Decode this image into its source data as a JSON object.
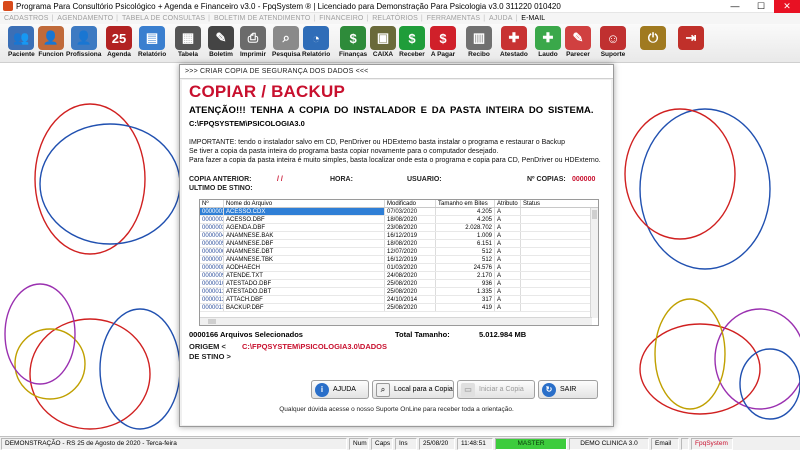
{
  "window": {
    "title": "Programa Para Consultório Psicológico + Agenda e Financeiro v3.0 - FpqSystem ® | Licenciado para  Demonstração Para Psicologia v3.0 311220 010420",
    "min": "—",
    "max": "☐",
    "close": "✕"
  },
  "menu": [
    {
      "label": "CADASTROS",
      "active": false
    },
    {
      "label": "AGENDAMENTO",
      "active": false
    },
    {
      "label": "TABELA DE CONSULTAS",
      "active": false
    },
    {
      "label": "BOLETIM DE ATENDIMENTO",
      "active": false
    },
    {
      "label": "FINANCEIRO",
      "active": false
    },
    {
      "label": "RELATÓRIOS",
      "active": false
    },
    {
      "label": "FERRAMENTAS",
      "active": false
    },
    {
      "label": "AJUDA",
      "active": false
    },
    {
      "label": "E-MAIL",
      "active": true
    }
  ],
  "toolbar": [
    {
      "label": "Paciente",
      "icon": "patients-icon",
      "color": "#3b6fb6",
      "glyph": "👥"
    },
    {
      "label": "Funcion",
      "icon": "employee-icon",
      "color": "#c06a3a",
      "glyph": "👤"
    },
    {
      "label": "Profissiona",
      "icon": "professional-icon",
      "color": "#3d7ac2",
      "glyph": "👤"
    },
    {
      "label": "Agenda",
      "icon": "calendar-icon",
      "color": "#b22222",
      "glyph": "25"
    },
    {
      "label": "Relatório",
      "icon": "report-icon",
      "color": "#3a7fcf",
      "glyph": "▤"
    },
    {
      "label": "Tabela",
      "icon": "table-icon",
      "color": "#555555",
      "glyph": "▦"
    },
    {
      "label": "Boletim",
      "icon": "bulletin-icon",
      "color": "#444444",
      "glyph": "✎"
    },
    {
      "label": "Imprimir",
      "icon": "printer-icon",
      "color": "#6b6b6b",
      "glyph": "⎙"
    },
    {
      "label": "Pesquisa",
      "icon": "search-icon",
      "color": "#8a8a8a",
      "glyph": "⌕"
    },
    {
      "label": "Relatório",
      "icon": "report-chart-icon",
      "color": "#2f6db8",
      "glyph": "◔"
    },
    {
      "label": "Finanças",
      "icon": "finance-icon",
      "color": "#2e8b3a",
      "glyph": "$"
    },
    {
      "label": "CAIXA",
      "icon": "cashbox-icon",
      "color": "#6a6a3a",
      "glyph": "▣"
    },
    {
      "label": "Receber",
      "icon": "receive-icon",
      "color": "#1f9d3a",
      "glyph": "$"
    },
    {
      "label": "A Pagar",
      "icon": "pay-icon",
      "color": "#d0202a",
      "glyph": "$"
    },
    {
      "label": "Recibo",
      "icon": "receipt-icon",
      "color": "#707070",
      "glyph": "▥"
    },
    {
      "label": "Atestado",
      "icon": "certificate-icon",
      "color": "#c83232",
      "glyph": "✚"
    },
    {
      "label": "Laudo",
      "icon": "report-doc-icon",
      "color": "#3aa84a",
      "glyph": "✚"
    },
    {
      "label": "Parecer",
      "icon": "opinion-icon",
      "color": "#d04040",
      "glyph": "✎"
    },
    {
      "label": "Suporte",
      "icon": "support-icon",
      "color": "#c03030",
      "glyph": "☺"
    },
    {
      "label": "",
      "icon": "power-icon",
      "color": "#a07a20",
      "glyph": "⏻"
    },
    {
      "label": "",
      "icon": "exit-icon",
      "color": "#c0302a",
      "glyph": "⇥"
    }
  ],
  "dialog": {
    "title": ">>> CRIAR COPIA DE SEGURANÇA DOS DADOS <<<",
    "heading": "COPIAR / BACKUP",
    "attention": "ATENÇÃO!!!  TENHA A COPIA DO INSTALADOR E DA PASTA INTEIRA DO SISTEMA.",
    "path": "C:\\FPQSYSTEM\\PSICOLOGIA3.0",
    "info": [
      "IMPORTANTE: tendo o instalador salvo em CD, PenDriver ou HDExterno basta instalar o programa e restaurar o Backup",
      "Se tiver a copia da pasta inteira do programa basta copiar novamente para o computador desejado.",
      "Para fazer a copia da pasta inteira é muito simples, basta localizar onde esta o programa e copia para CD, PenDriver ou HDExterno."
    ],
    "last_copy_label": "COPIA ANTERIOR:",
    "last_copy_value": "/  /",
    "hour_label": "HORA:",
    "user_label": "USUARIO:",
    "copies_label": "Nº COPIAS:",
    "copies_value": "000000",
    "last_dest_label": "ULTIMO DE STINO:",
    "grid": {
      "columns": [
        "Nº",
        "Nome do Arquivo",
        "Modificado",
        "Tamanho em Bites",
        "Atributo",
        "Status"
      ],
      "rows": [
        {
          "no": "0000001",
          "name": "ACESSO.CDX",
          "mod": "07/03/2020",
          "size": "4.205",
          "attr": "A",
          "status": ""
        },
        {
          "no": "0000002",
          "name": "ACESSO.DBF",
          "mod": "18/08/2020",
          "size": "4.205",
          "attr": "A",
          "status": ""
        },
        {
          "no": "0000003",
          "name": "AGENDA.DBF",
          "mod": "23/08/2020",
          "size": "2.028.702",
          "attr": "A",
          "status": ""
        },
        {
          "no": "0000004",
          "name": "ANAMNESE.BAK",
          "mod": "16/12/2019",
          "size": "1.009",
          "attr": "A",
          "status": ""
        },
        {
          "no": "0000005",
          "name": "ANAMNESE.DBF",
          "mod": "18/08/2020",
          "size": "6.151",
          "attr": "A",
          "status": ""
        },
        {
          "no": "0000006",
          "name": "ANAMNESE.DBT",
          "mod": "12/07/2020",
          "size": "512",
          "attr": "A",
          "status": ""
        },
        {
          "no": "0000007",
          "name": "ANAMNESE.TBK",
          "mod": "16/12/2019",
          "size": "512",
          "attr": "A",
          "status": ""
        },
        {
          "no": "0000008",
          "name": "AODHAECH",
          "mod": "01/03/2020",
          "size": "24.576",
          "attr": "A",
          "status": ""
        },
        {
          "no": "0000009",
          "name": "ATENDE.TXT",
          "mod": "24/08/2020",
          "size": "2.170",
          "attr": "A",
          "status": ""
        },
        {
          "no": "0000010",
          "name": "ATESTADO.DBF",
          "mod": "25/08/2020",
          "size": "936",
          "attr": "A",
          "status": ""
        },
        {
          "no": "0000011",
          "name": "ATESTADO.DBT",
          "mod": "25/08/2020",
          "size": "1.335",
          "attr": "A",
          "status": ""
        },
        {
          "no": "0000012",
          "name": "ATTACH.DBF",
          "mod": "24/10/2014",
          "size": "317",
          "attr": "A",
          "status": ""
        },
        {
          "no": "0000013",
          "name": "BACKUP.DBF",
          "mod": "25/08/2020",
          "size": "419",
          "attr": "A",
          "status": ""
        }
      ]
    },
    "selected_count": "0000166 Arquivos Selecionados",
    "total_label": "Total Tamanho:",
    "total_value": "5.012.984 MB",
    "origin_label": "ORIGEM  <",
    "origin_value": "C:\\FPQSYSTEM\\PSICOLOGIA3.0\\DADOS",
    "dest_label": "DE STINO >",
    "buttons": {
      "help": "AJUDA",
      "local": "Local para a Copia",
      "start": "Iniciar a Copia",
      "exit": "SAIR"
    },
    "footer": "Qualquer dúvida acesse o nosso Suporte OnLine para receber toda a orientação."
  },
  "status": {
    "mode": "DEMONSTRAÇÃO - RS 25 de Agosto de 2020 - Terca-feira",
    "num": "Num",
    "caps": "Caps",
    "ins": "Ins",
    "date": "25/08/20",
    "time": "11:48:51",
    "master": "MASTER",
    "clinic": "DEMO CLINICA 3.0",
    "email": "Email",
    "brand": "FpqSystem"
  }
}
